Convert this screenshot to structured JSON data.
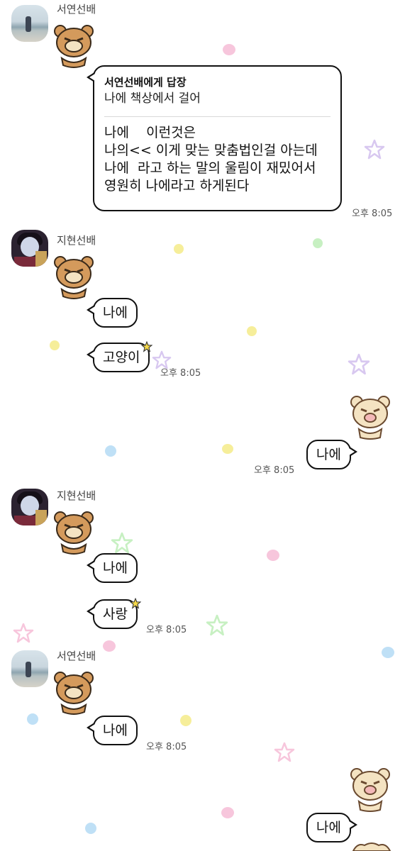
{
  "colors": {
    "bubble_border": "#111111",
    "background": "#ffffff",
    "dot_pink": "#f7c6dc",
    "dot_yellow": "#f6ee9a",
    "dot_green": "#c7f0c2",
    "dot_blue": "#bfe0f6",
    "star_purple": "#d8c8f0",
    "bear_tan": "#d49a5c",
    "bear_cream": "#f4e3c2"
  },
  "chat": {
    "group1": {
      "sender": "서연선배",
      "avatar_icon": "beach-photo-avatar",
      "reply_to": "서연선배에게 답장",
      "reply_quote": "나에 책상에서 걸어",
      "message_lines": [
        "나에    이런것은",
        "나의<< 이게 맞는 맞춤법인걸 아는데",
        "나에  라고 하는 말의 울림이 재밌어서",
        "영원히 나에라고 하게된다"
      ],
      "time": "오후 8:05"
    },
    "group2": {
      "sender": "지현선배",
      "avatar_icon": "doll-avatar",
      "messages": [
        "나에",
        "고양이"
      ],
      "time": "오후 8:05"
    },
    "mine1": {
      "message": "나에",
      "time": "오후 8:05"
    },
    "group3": {
      "sender": "지현선배",
      "avatar_icon": "doll-avatar",
      "messages": [
        "나에",
        "사랑"
      ],
      "time": "오후 8:05"
    },
    "group4": {
      "sender": "서연선배",
      "avatar_icon": "beach-photo-avatar",
      "messages": [
        "나에"
      ],
      "time": "오후 8:05"
    },
    "mine2": {
      "message": "나에"
    }
  }
}
